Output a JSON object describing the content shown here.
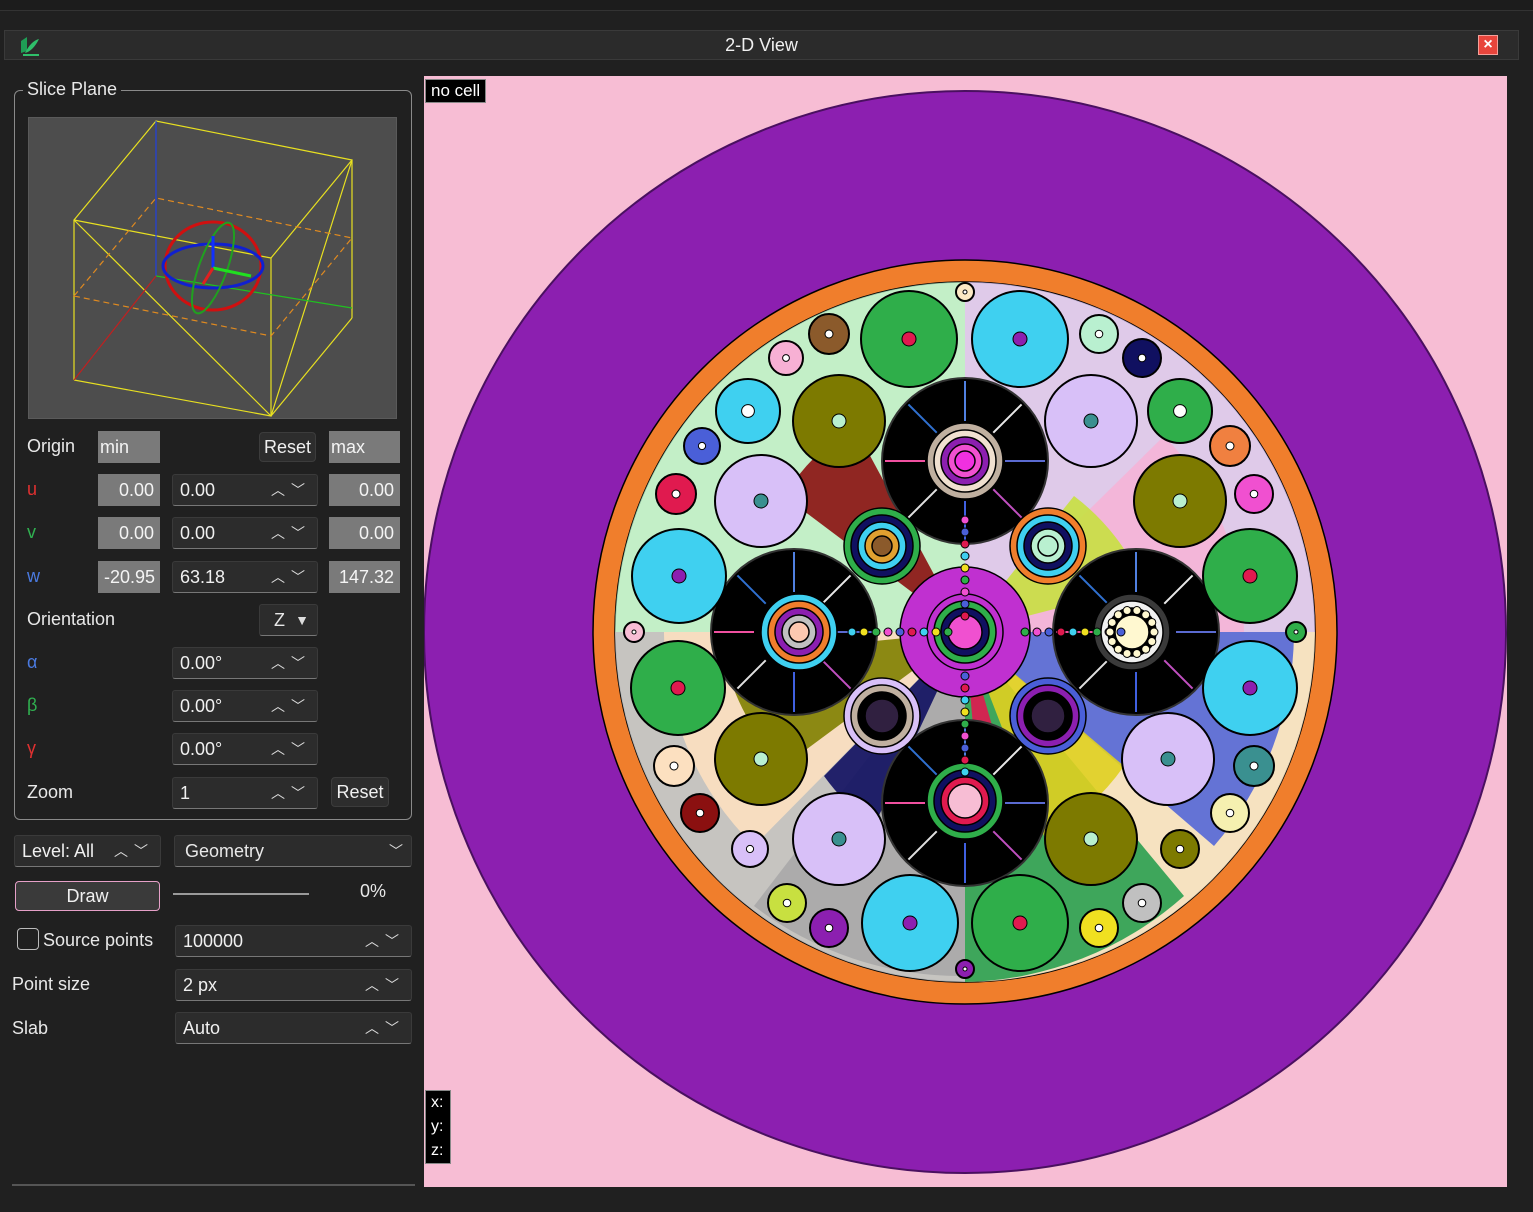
{
  "window": {
    "title": "2-D View",
    "close_symbol": "×"
  },
  "slice_plane": {
    "group_title": "Slice Plane",
    "origin_label": "Origin",
    "min_label": "min",
    "max_label": "max",
    "reset_label": "Reset",
    "rows": [
      {
        "axis": "u",
        "min": "0.00",
        "value": "0.00",
        "max": "0.00"
      },
      {
        "axis": "v",
        "min": "0.00",
        "value": "0.00",
        "max": "0.00"
      },
      {
        "axis": "w",
        "min": "-20.95",
        "value": "63.18",
        "max": "147.32"
      }
    ],
    "orientation_label": "Orientation",
    "orientation_value": "Z",
    "angles": [
      {
        "symbol": "α",
        "value": "0.00°"
      },
      {
        "symbol": "β",
        "value": "0.00°"
      },
      {
        "symbol": "γ",
        "value": "0.00°"
      }
    ],
    "zoom_label": "Zoom",
    "zoom_value": "1",
    "zoom_reset_label": "Reset"
  },
  "controls": {
    "level_label": "Level: All",
    "mode_value": "Geometry",
    "draw_label": "Draw",
    "progress_text": "0%",
    "progress_fraction": 0,
    "source_points_label": "Source points",
    "source_points_value": "100000",
    "point_size_label": "Point size",
    "point_size_value": "2 px",
    "slab_label": "Slab",
    "slab_value": "Auto"
  },
  "viewport": {
    "cell_label": "no cell",
    "coord_x": "x:",
    "coord_y": "y:",
    "coord_z": "z:",
    "colors": {
      "background": "#f7bdd4",
      "outer_ring": "#8c1fb0",
      "reflector_ring": "#f07e2c",
      "core_fill": "#fce9c4",
      "channel_black": "#000000"
    }
  },
  "icons": {
    "app": "leaf-logo-icon",
    "close": "close-icon",
    "spin": "chevron-up-down-icon",
    "dropdown": "chevron-down-icon"
  }
}
